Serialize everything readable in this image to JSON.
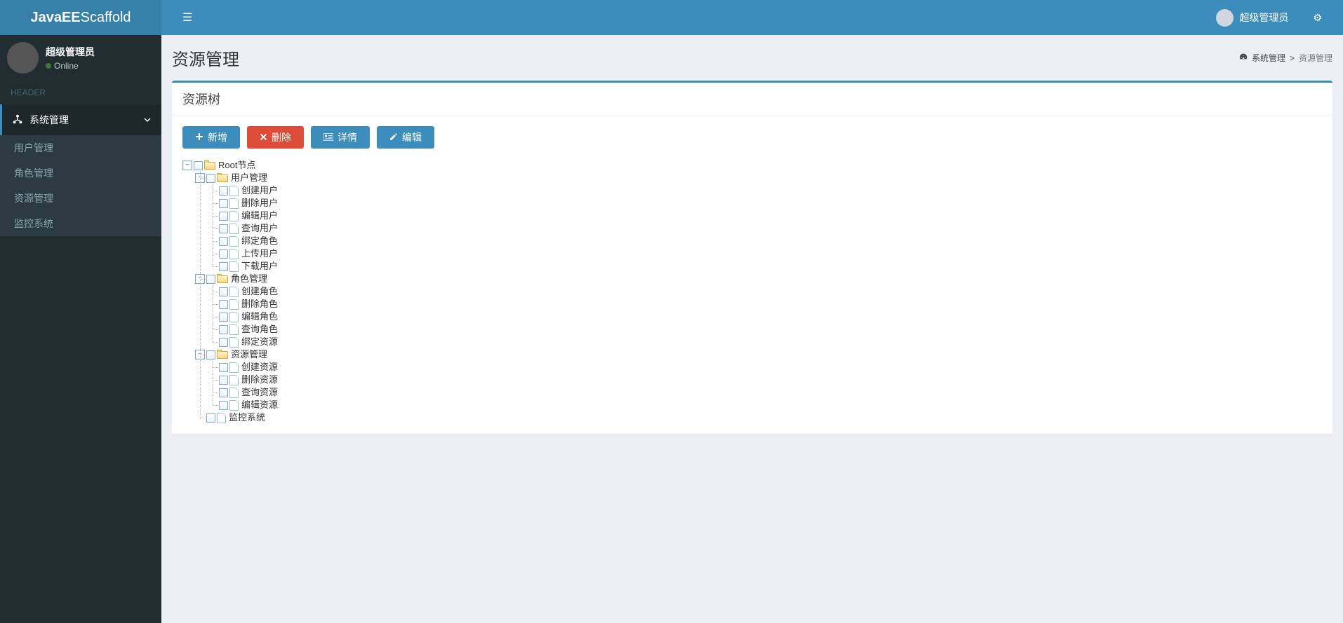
{
  "brand": {
    "bold": "JavaEE",
    "light": "Scaffold"
  },
  "header": {
    "user_name": "超级管理员"
  },
  "sidebar": {
    "user_name": "超级管理员",
    "status": "Online",
    "header": "HEADER",
    "menu_title": "系统管理",
    "items": [
      {
        "label": "用户管理"
      },
      {
        "label": "角色管理"
      },
      {
        "label": "资源管理"
      },
      {
        "label": "监控系统"
      }
    ]
  },
  "page": {
    "title": "资源管理",
    "breadcrumb_root": "系统管理",
    "breadcrumb_active": "资源管理"
  },
  "box": {
    "title": "资源树"
  },
  "buttons": {
    "add": "新增",
    "delete": "删除",
    "detail": "详情",
    "edit": "编辑"
  },
  "tree": {
    "root": "Root节点",
    "n1": "用户管理",
    "n1c": [
      "创建用户",
      "删除用户",
      "编辑用户",
      "查询用户",
      "绑定角色",
      "上传用户",
      "下载用户"
    ],
    "n2": "角色管理",
    "n2c": [
      "创建角色",
      "删除角色",
      "编辑角色",
      "查询角色",
      "绑定资源"
    ],
    "n3": "资源管理",
    "n3c": [
      "创建资源",
      "删除资源",
      "查询资源",
      "编辑资源"
    ],
    "n4": "监控系统"
  }
}
